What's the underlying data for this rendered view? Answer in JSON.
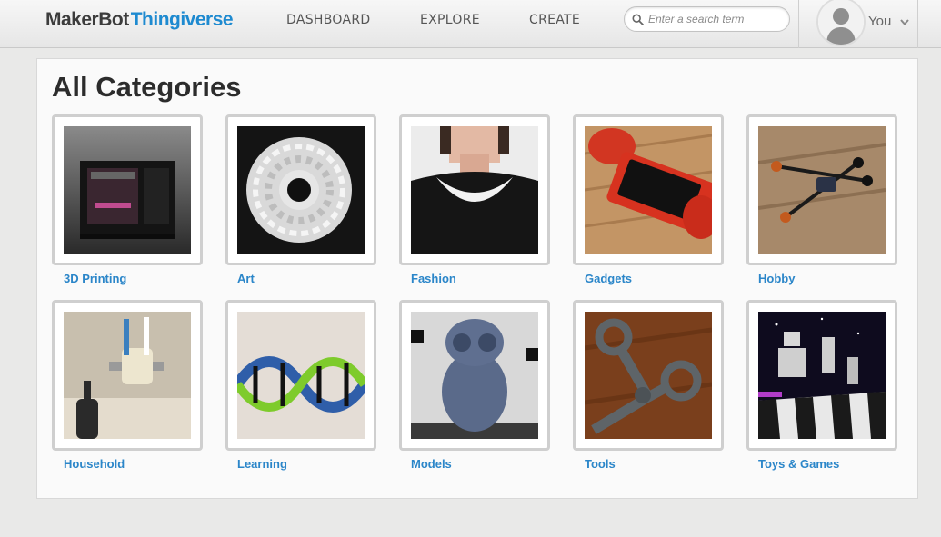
{
  "header": {
    "logo_maker": "MakerBot",
    "logo_thing": "Thingiverse",
    "nav": [
      {
        "label": "DASHBOARD"
      },
      {
        "label": "EXPLORE"
      },
      {
        "label": "CREATE"
      }
    ],
    "search": {
      "placeholder": "Enter a search term",
      "icon": "search-icon"
    },
    "user": {
      "label": "You",
      "icon": "avatar-silhouette"
    }
  },
  "main": {
    "title": "All Categories",
    "categories": [
      {
        "label": "3D Printing",
        "image": "3d-printer-photo"
      },
      {
        "label": "Art",
        "image": "lattice-sculpture-photo"
      },
      {
        "label": "Fashion",
        "image": "printed-necklace-photo"
      },
      {
        "label": "Gadgets",
        "image": "phone-speaker-dock-photo"
      },
      {
        "label": "Hobby",
        "image": "quadcopter-photo"
      },
      {
        "label": "Household",
        "image": "toothbrush-holder-photo"
      },
      {
        "label": "Learning",
        "image": "dna-model-photo"
      },
      {
        "label": "Models",
        "image": "owl-figure-photo"
      },
      {
        "label": "Tools",
        "image": "scissors-tool-photo"
      },
      {
        "label": "Toys & Games",
        "image": "robot-chess-photo"
      }
    ]
  },
  "colors": {
    "brand_blue": "#1e8ad0",
    "link_blue": "#2b86c9",
    "background": "#e9e9e8"
  }
}
